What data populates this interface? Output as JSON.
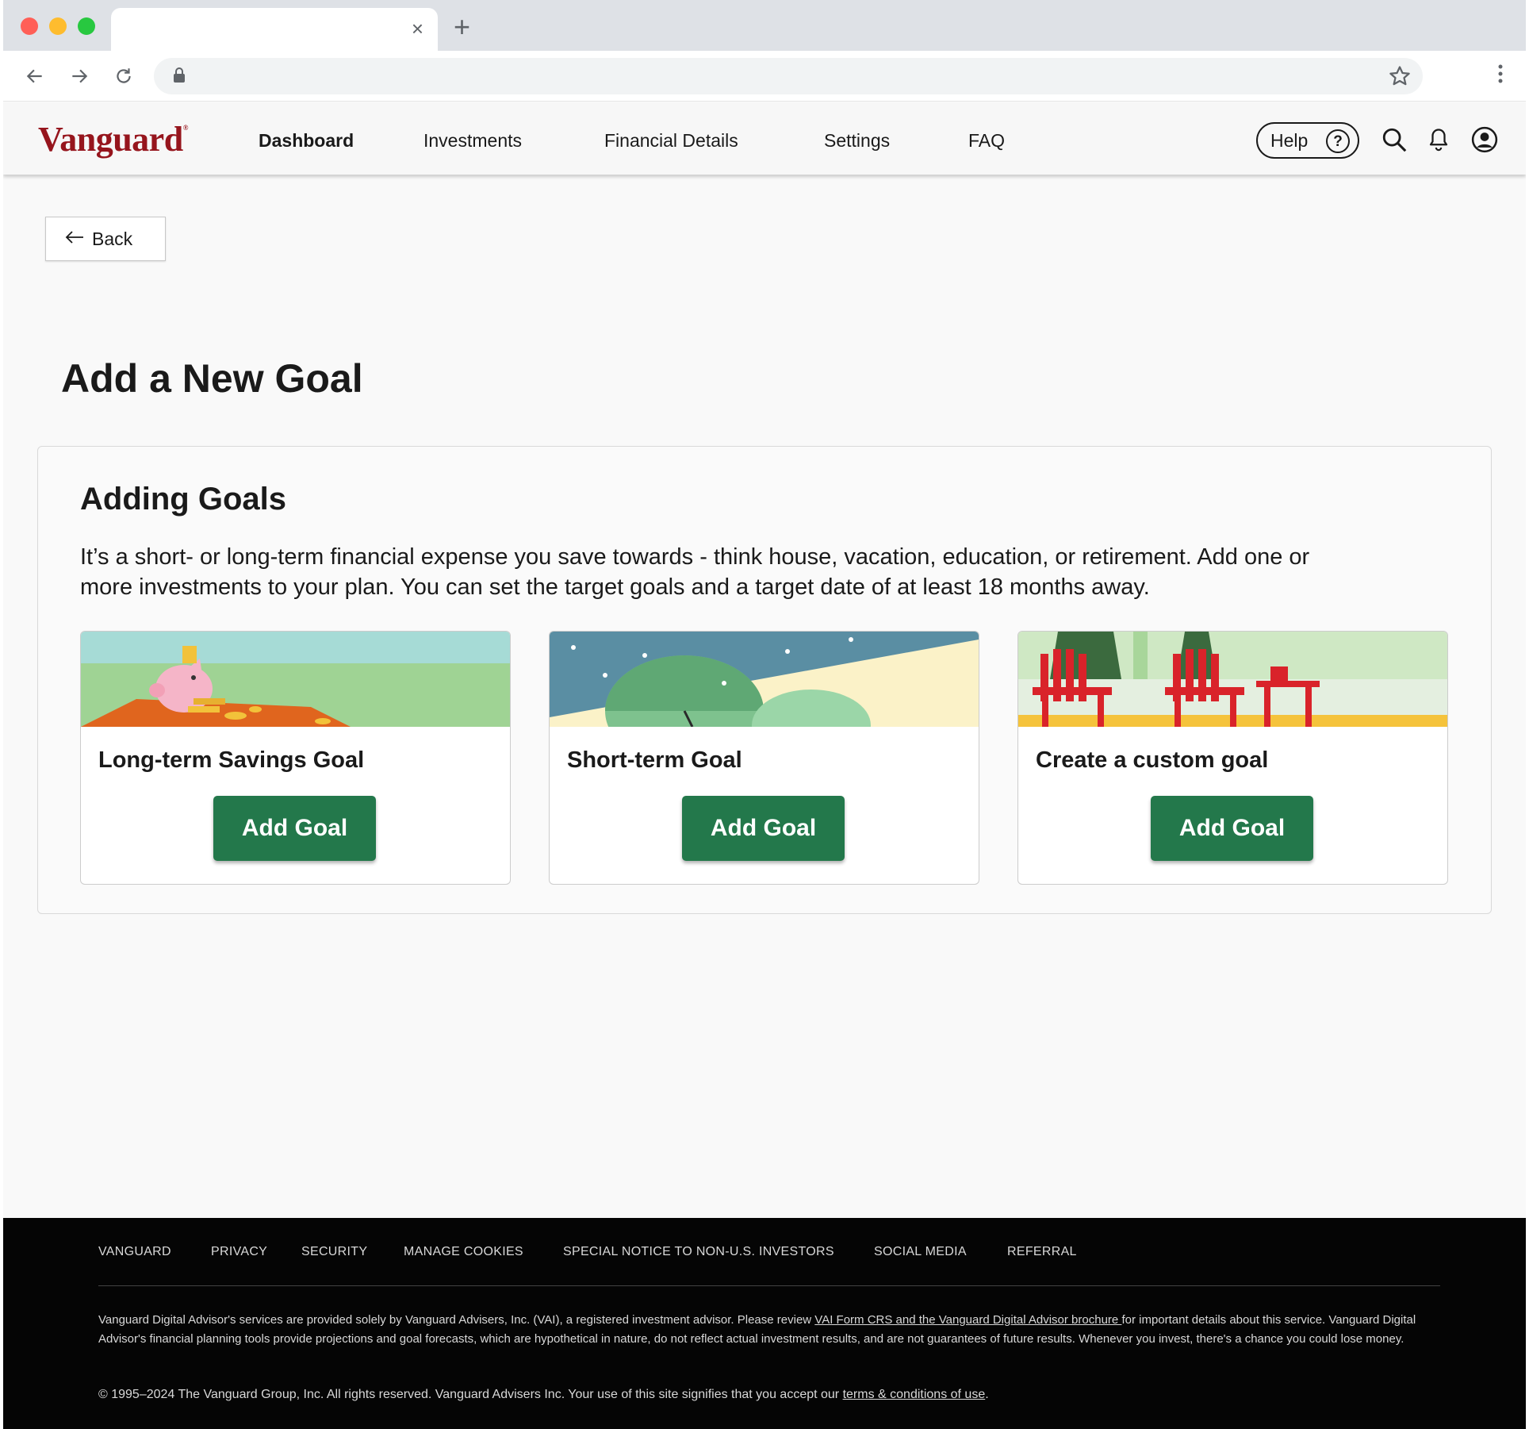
{
  "browser": {
    "tab_close": "×",
    "new_tab": "+"
  },
  "header": {
    "logo": "Vanguard",
    "logo_mark": "®",
    "nav": [
      "Dashboard",
      "Investments",
      "Financial Details",
      "Settings",
      "FAQ"
    ],
    "active_nav": "Dashboard",
    "help_label": "Help",
    "help_icon_glyph": "?"
  },
  "page": {
    "back_label": "Back",
    "title": "Add a New Goal"
  },
  "panel": {
    "title": "Adding Goals",
    "description": "It’s a short- or long-term financial expense you save towards - think house, vacation, education, or retirement. Add one or more investments to your plan. You can set the target goals and a target date of at least 18 months away."
  },
  "cards": [
    {
      "title": "Long-term Savings Goal",
      "button": "Add Goal"
    },
    {
      "title": "Short-term Goal",
      "button": "Add Goal"
    },
    {
      "title": "Create a custom goal",
      "button": "Add Goal"
    }
  ],
  "footer": {
    "links": [
      "VANGUARD",
      "PRIVACY",
      "SECURITY",
      "MANAGE COOKIES",
      "SPECIAL NOTICE TO NON-U.S. INVESTORS",
      "SOCIAL MEDIA",
      "REFERRAL"
    ],
    "disclosure_pre": "Vanguard Digital Advisor's services are provided solely by Vanguard Advisers, Inc. (VAI), a registered investment advisor. Please review ",
    "disclosure_link": "VAI Form CRS and the Vanguard Digital Advisor brochure ",
    "disclosure_post": " for important details about this service. Vanguard Digital Advisor's financial planning tools provide projections and goal forecasts, which are hypothetical in nature, do not reflect actual investment results, and are not guarantees of future results. Whenever you invest, there's a chance you could lose money.",
    "copyright_pre": "© 1995–2024 The Vanguard Group, Inc. All rights reserved. Vanguard Advisers Inc. Your use of this site signifies that you accept our ",
    "copyright_link": "terms & conditions of use",
    "copyright_post": "."
  },
  "colors": {
    "brand": "#96151d",
    "button_green": "#23784b",
    "footer_bg": "#050505"
  },
  "icons": {
    "browser": [
      "back-arrow-icon",
      "forward-arrow-icon",
      "reload-icon",
      "lock-icon",
      "star-icon",
      "kebab-menu-icon"
    ],
    "header": [
      "help-icon",
      "search-icon",
      "bell-icon",
      "account-icon"
    ],
    "page": [
      "back-arrow-icon"
    ]
  }
}
